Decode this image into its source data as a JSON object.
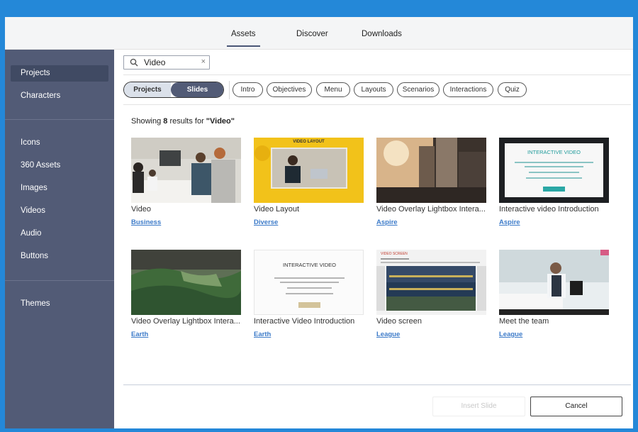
{
  "top_tabs": [
    {
      "label": "Assets",
      "active": true
    },
    {
      "label": "Discover",
      "active": false
    },
    {
      "label": "Downloads",
      "active": false
    }
  ],
  "sidebar": {
    "items": [
      {
        "label": "Projects",
        "active": true
      },
      {
        "label": "Characters"
      },
      {
        "label": "Icons"
      },
      {
        "label": "360 Assets"
      },
      {
        "label": "Images"
      },
      {
        "label": "Videos"
      },
      {
        "label": "Audio"
      },
      {
        "label": "Buttons"
      },
      {
        "label": "Themes"
      }
    ]
  },
  "search": {
    "value": "Video",
    "clear_symbol": "×"
  },
  "segmented": {
    "left": "Projects",
    "right": "Slides",
    "selected": "Slides"
  },
  "filters": [
    "Intro",
    "Objectives",
    "Menu",
    "Layouts",
    "Scenarios",
    "Interactions",
    "Quiz"
  ],
  "results": {
    "prefix": "Showing ",
    "count": "8",
    "middle": " results for ",
    "query": "\"Video\""
  },
  "cards": [
    {
      "title": "Video",
      "tag": "Business"
    },
    {
      "title": "Video Layout",
      "tag": "Diverse",
      "thumb_text": "VIDEO LAYOUT"
    },
    {
      "title": "Video Overlay Lightbox Intera...",
      "tag": "Aspire"
    },
    {
      "title": "Interactive video Introduction",
      "tag": "Aspire",
      "thumb_text": "INTERACTIVE VIDEO"
    },
    {
      "title": "Video Overlay Lightbox Intera...",
      "tag": "Earth"
    },
    {
      "title": "Interactive Video Introduction",
      "tag": "Earth",
      "thumb_text": "INTERACTIVE VIDEO"
    },
    {
      "title": "Video screen",
      "tag": "League",
      "thumb_text": "VIDEO SCREEN"
    },
    {
      "title": "Meet the team",
      "tag": "League"
    }
  ],
  "footer": {
    "insert_label": "Insert Slide",
    "cancel_label": "Cancel"
  },
  "colors": {
    "sidebar": "#525b76",
    "accent_link": "#3d7bc9",
    "frame": "#2488d8",
    "segment_active": "#525b76"
  }
}
